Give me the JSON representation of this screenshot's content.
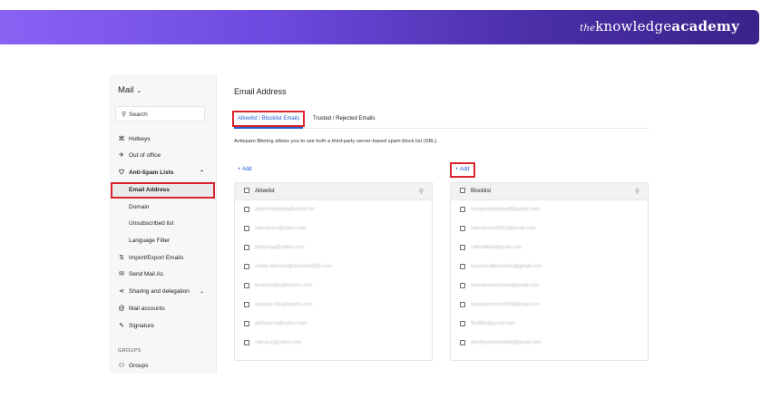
{
  "banner": {
    "brand_the": "the",
    "brand_knowledge": "knowledge",
    "brand_academy": "academy"
  },
  "sidebar": {
    "title": "Mail",
    "search_label": "Search",
    "items": [
      {
        "label": "Hotkeys",
        "icon": "command-icon"
      },
      {
        "label": "Out of office",
        "icon": "plane-icon"
      },
      {
        "label": "Anti-Spam Lists",
        "icon": "shield-icon"
      },
      {
        "label": "Email Address"
      },
      {
        "label": "Domain"
      },
      {
        "label": "Unsubscribed list"
      },
      {
        "label": "Language Filter"
      },
      {
        "label": "Import/Export Emails",
        "icon": "import-export-icon"
      },
      {
        "label": "Send Mail As",
        "icon": "send-icon"
      },
      {
        "label": "Sharing and delegation",
        "icon": "share-icon"
      },
      {
        "label": "Mail accounts",
        "icon": "at-icon"
      },
      {
        "label": "Signature",
        "icon": "signature-icon"
      }
    ],
    "groups_header": "GROUPS",
    "groups_item": "Groups"
  },
  "main": {
    "title": "Email Address",
    "tabs": [
      "Allowlist / Blocklist Emails",
      "Trusted / Rejected Emails"
    ],
    "description": "Antispam filtering allows you to use both a third-party server-based spam block list (SBL).",
    "add_label": "+ Add",
    "allowlist": {
      "header": "Allowlist",
      "emails": [
        "zylkermarketing@amrith.tk",
        "salesteam@zylker.com",
        "testgroup@zylker.com",
        "mailer-daemon@zohomail365.com",
        "bounces@zylkertech.com",
        "arindam.das@sweris.com",
        "anthony.m@zylker.com",
        "rathna.k@zylker.com"
      ]
    },
    "blocklist": {
      "header": "Blocklist",
      "emails": [
        "margaretbakergaff@gmail.com",
        "wilsonjones2021@gmail.com",
        "ruthhallto5@gmail.com",
        "laurentcoffimontcho@gmail.com",
        "donnabrownwheat@gmail.com",
        "susanturnersmith0@gmail.com",
        "flint982@gmail.com",
        "dorothyedwardshi0@gmail.com"
      ]
    }
  },
  "colors": {
    "accent": "#1f5fd6",
    "highlight": "#d9232d"
  }
}
